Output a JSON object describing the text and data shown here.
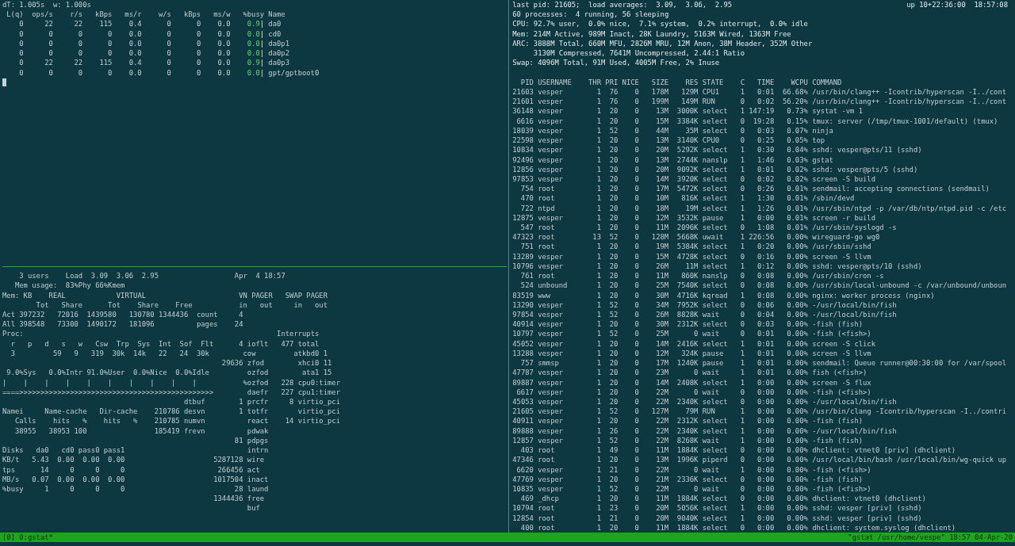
{
  "gstat": {
    "header": "dT: 1.005s  w: 1.000s",
    "columns": [
      "L(q)",
      "ops/s",
      "r/s",
      "kBps",
      "ms/r",
      "w/s",
      "kBps",
      "ms/w",
      "%busy",
      "Name"
    ],
    "rows": [
      {
        "cells": [
          "0",
          "22",
          "22",
          "115",
          "0.4",
          "0",
          "0",
          "0.0"
        ],
        "busy": "0.9",
        "name": "da0"
      },
      {
        "cells": [
          "0",
          "0",
          "0",
          "0",
          "0.0",
          "0",
          "0",
          "0.0"
        ],
        "busy": "0.0",
        "name": "cd0"
      },
      {
        "cells": [
          "0",
          "0",
          "0",
          "0",
          "0.0",
          "0",
          "0",
          "0.0"
        ],
        "busy": "0.0",
        "name": "da0p1"
      },
      {
        "cells": [
          "0",
          "0",
          "0",
          "0",
          "0.0",
          "0",
          "0",
          "0.0"
        ],
        "busy": "0.0",
        "name": "da0p2"
      },
      {
        "cells": [
          "0",
          "22",
          "22",
          "115",
          "0.4",
          "0",
          "0",
          "0.0"
        ],
        "busy": "0.9",
        "name": "da0p3"
      },
      {
        "cells": [
          "0",
          "0",
          "0",
          "0",
          "0.0",
          "0",
          "0",
          "0.0"
        ],
        "busy": "0.0",
        "name": "gpt/gptboot0"
      }
    ]
  },
  "systat": {
    "lines": [
      "    3 users    Load  3.09  3.06  2.95                  Apr  4 18:57",
      "   Mem usage:  83%Phy 66%Kmem",
      "Mem: KB    REAL            VIRTUAL                      VN PAGER   SWAP PAGER",
      "        Tot   Share      Tot    Share    Free           in   out     in   out",
      "Act 397232   72016  1439580   130780 1344436  count     4",
      "All 398548   73300  1490172   181096          pages    24",
      "Proc:                                                            Interrupts",
      "  r   p   d   s   w   Csw  Trp  Sys  Int  Sof  Flt      4 ioflt   477 total",
      "  3         59   9   319  30k  14k   22   24  30k        cow         atkbd0 1",
      "                                                    29636 zfod        xhci0 11",
      " 9.0%Sys   0.0%Intr 91.0%User  0.0%Nice  0.0%Idle         ozfod        ata1 15",
      "|    |    |    |    |    |    |    |    |    |           %ozfod   228 cpu0:timer",
      "====>>>>>>>>>>>>>>>>>>>>>>>>>>>>>>>>>>>>>>>>>>>>>>        daefr   227 cpu1:timer",
      "                                           dtbuf        1 prcfr     8 virtio_pci",
      "Namei     Name-cache   Dir-cache    210786 desvn        1 totfr       virtio_pci",
      "   Calls    hits   %    hits   %    210785 numvn          react    14 virtio_pci",
      "   38955   38953 100                185419 frevn          pdwak",
      "                                                       81 pdpgs",
      "Disks   da0   cd0 pass0 pass1                             intrn",
      "KB/t   5.43  0.00  0.00  0.00                     5287128 wire",
      "tps      14     0     0     0                      266456 act",
      "MB/s   0.07  0.00  0.00  0.00                     1017504 inact",
      "%busy     1     0     0     0                          28 laund",
      "                                                  1344436 free",
      "                                                          buf"
    ]
  },
  "top": {
    "load": "last pid: 21605;  load averages:  3.09,  3.06,  2.95",
    "uptime": "up 10+22:36:00  18:57:08",
    "summary": [
      "60 processes:  4 running, 56 sleeping",
      "CPU: 92.7% user,  0.0% nice,  7.1% system,  0.2% interrupt,  0.0% idle",
      "Mem: 214M Active, 989M Inact, 28K Laundry, 5163M Wired, 1363M Free",
      "ARC: 3888M Total, 660M MFU, 2826M MRU, 12M Anon, 38M Header, 352M Other",
      "     3130M Compressed, 7641M Uncompressed, 2.44:1 Ratio",
      "Swap: 4096M Total, 91M Used, 4005M Free, 2% Inuse"
    ],
    "columns": [
      "PID",
      "USERNAME",
      "THR",
      "PRI",
      "NICE",
      "SIZE",
      "RES",
      "STATE",
      "C",
      "TIME",
      "WCPU",
      "COMMAND"
    ],
    "rows": [
      [
        "21603",
        "vesper",
        "1",
        "76",
        "0",
        "178M",
        "129M",
        "CPU1",
        "1",
        "0:01",
        "66.68%",
        "/usr/bin/clang++ -Icontrib/hyperscan -I../cont"
      ],
      [
        "21601",
        "vesper",
        "1",
        "76",
        "0",
        "199M",
        "149M",
        "RUN",
        "0",
        "0:02",
        "56.20%",
        "/usr/bin/clang++ -Icontrib/hyperscan -I../cont"
      ],
      [
        "36148",
        "vesper",
        "1",
        "20",
        "0",
        "13M",
        "3000K",
        "select",
        "1",
        "147:19",
        "0.73%",
        "systat -vm 1"
      ],
      [
        "6616",
        "vesper",
        "1",
        "20",
        "0",
        "15M",
        "3384K",
        "select",
        "0",
        "19:28",
        "0.15%",
        "tmux: server (/tmp/tmux-1001/default) (tmux)"
      ],
      [
        "18039",
        "vesper",
        "1",
        "52",
        "0",
        "44M",
        "35M",
        "select",
        "0",
        "0:03",
        "0.07%",
        "ninja"
      ],
      [
        "22598",
        "vesper",
        "1",
        "20",
        "0",
        "13M",
        "3140K",
        "CPU0",
        "0",
        "0:25",
        "0.05%",
        "top"
      ],
      [
        "10834",
        "vesper",
        "1",
        "20",
        "0",
        "20M",
        "5292K",
        "select",
        "1",
        "0:30",
        "0.04%",
        "sshd: vesper@pts/11 (sshd)"
      ],
      [
        "92496",
        "vesper",
        "1",
        "20",
        "0",
        "13M",
        "2744K",
        "nanslp",
        "1",
        "1:46",
        "0.03%",
        "gstat"
      ],
      [
        "12856",
        "vesper",
        "1",
        "20",
        "0",
        "20M",
        "9092K",
        "select",
        "1",
        "0:01",
        "0.02%",
        "sshd: vesper@pts/5 (sshd)"
      ],
      [
        "97853",
        "vesper",
        "1",
        "20",
        "0",
        "14M",
        "3920K",
        "select",
        "0",
        "0:02",
        "0.02%",
        "screen -S build"
      ],
      [
        "754",
        "root",
        "1",
        "20",
        "0",
        "17M",
        "5472K",
        "select",
        "0",
        "0:26",
        "0.01%",
        "sendmail: accepting connections (sendmail)"
      ],
      [
        "470",
        "root",
        "1",
        "20",
        "0",
        "10M",
        "816K",
        "select",
        "1",
        "1:30",
        "0.01%",
        "/sbin/devd"
      ],
      [
        "722",
        "ntpd",
        "1",
        "20",
        "0",
        "18M",
        "19M",
        "select",
        "1",
        "1:26",
        "0.01%",
        "/usr/sbin/ntpd -p /var/db/ntp/ntpd.pid -c /etc"
      ],
      [
        "12875",
        "vesper",
        "1",
        "20",
        "0",
        "12M",
        "3532K",
        "pause",
        "1",
        "0:00",
        "0.01%",
        "screen -r build"
      ],
      [
        "547",
        "root",
        "1",
        "20",
        "0",
        "11M",
        "2096K",
        "select",
        "0",
        "1:08",
        "0.01%",
        "/usr/sbin/syslogd -s"
      ],
      [
        "47323",
        "root",
        "13",
        "52",
        "0",
        "128M",
        "5668K",
        "uwait",
        "1",
        "226:56",
        "0.00%",
        "wireguard-go wg0"
      ],
      [
        "751",
        "root",
        "1",
        "20",
        "0",
        "19M",
        "5384K",
        "select",
        "1",
        "0:20",
        "0.00%",
        "/usr/sbin/sshd"
      ],
      [
        "13289",
        "vesper",
        "1",
        "20",
        "0",
        "15M",
        "4728K",
        "select",
        "0",
        "0:16",
        "0.00%",
        "screen -S llvm"
      ],
      [
        "10796",
        "vesper",
        "1",
        "20",
        "0",
        "26M",
        "11M",
        "select",
        "1",
        "0:12",
        "0.00%",
        "sshd: vesper@pts/10 (sshd)"
      ],
      [
        "761",
        "root",
        "1",
        "20",
        "0",
        "11M",
        "860K",
        "nanslp",
        "0",
        "0:08",
        "0.00%",
        "/usr/sbin/cron -s"
      ],
      [
        "524",
        "unbound",
        "1",
        "20",
        "0",
        "25M",
        "7540K",
        "select",
        "0",
        "0:08",
        "0.00%",
        "/usr/sbin/local-unbound -c /var/unbound/unboun"
      ],
      [
        "83519",
        "www",
        "1",
        "20",
        "0",
        "30M",
        "4716K",
        "kqread",
        "1",
        "0:08",
        "0.00%",
        "nginx: worker process (nginx)"
      ],
      [
        "13290",
        "vesper",
        "1",
        "52",
        "0",
        "34M",
        "7952K",
        "select",
        "0",
        "0:06",
        "0.00%",
        "-/usr/local/bin/fish"
      ],
      [
        "97854",
        "vesper",
        "1",
        "52",
        "0",
        "26M",
        "8828K",
        "wait",
        "0",
        "0:04",
        "0.00%",
        "-/usr/local/bin/fish"
      ],
      [
        "40914",
        "vesper",
        "1",
        "20",
        "0",
        "30M",
        "2312K",
        "select",
        "0",
        "0:03",
        "0.00%",
        "-fish (fish)"
      ],
      [
        "10797",
        "vesper",
        "1",
        "52",
        "0",
        "25M",
        "0",
        "wait",
        "0",
        "0:01",
        "0.00%",
        "-fish (<fish>)"
      ],
      [
        "45052",
        "vesper",
        "1",
        "20",
        "0",
        "14M",
        "2416K",
        "select",
        "1",
        "0:01",
        "0.00%",
        "screen -S click"
      ],
      [
        "13288",
        "vesper",
        "1",
        "20",
        "0",
        "12M",
        "324K",
        "pause",
        "1",
        "0:01",
        "0.00%",
        "screen -S llvm"
      ],
      [
        "757",
        "smmsp",
        "1",
        "20",
        "0",
        "17M",
        "1240K",
        "pause",
        "1",
        "0:01",
        "0.00%",
        "sendmail: Queue runner@00:30:00 for /var/spool"
      ],
      [
        "47787",
        "vesper",
        "1",
        "20",
        "0",
        "23M",
        "0",
        "wait",
        "1",
        "0:01",
        "0.00%",
        "fish (<fish>)"
      ],
      [
        "89887",
        "vesper",
        "1",
        "20",
        "0",
        "14M",
        "2408K",
        "select",
        "1",
        "0:00",
        "0.00%",
        "screen -S flux"
      ],
      [
        "6617",
        "vesper",
        "1",
        "20",
        "0",
        "22M",
        "0",
        "wait",
        "0",
        "0:00",
        "0.00%",
        "-fish (<fish>)"
      ],
      [
        "45053",
        "vesper",
        "1",
        "20",
        "0",
        "22M",
        "2340K",
        "select",
        "0",
        "0:00",
        "0.00%",
        "-/usr/local/bin/fish"
      ],
      [
        "21605",
        "vesper",
        "1",
        "52",
        "0",
        "127M",
        "79M",
        "RUN",
        "1",
        "0:00",
        "0.00%",
        "/usr/bin/clang -Icontrib/hyperscan -I../contri"
      ],
      [
        "40911",
        "vesper",
        "1",
        "20",
        "0",
        "22M",
        "2312K",
        "select",
        "1",
        "0:00",
        "0.00%",
        "-fish (fish)"
      ],
      [
        "89888",
        "vesper",
        "1",
        "26",
        "0",
        "22M",
        "2340K",
        "select",
        "1",
        "0:00",
        "0.00%",
        "-/usr/local/bin/fish"
      ],
      [
        "12857",
        "vesper",
        "1",
        "52",
        "0",
        "22M",
        "8268K",
        "wait",
        "1",
        "0:00",
        "0.00%",
        "-fish (fish)"
      ],
      [
        "403",
        "root",
        "1",
        "49",
        "0",
        "11M",
        "1884K",
        "select",
        "0",
        "0:00",
        "0.00%",
        "dhclient: vtnet0 [priv] (dhclient)"
      ],
      [
        "47346",
        "root",
        "1",
        "20",
        "0",
        "13M",
        "1996K",
        "piperd",
        "0",
        "0:00",
        "0.00%",
        "/usr/local/bin/bash /usr/local/bin/wg-quick up"
      ],
      [
        "6620",
        "vesper",
        "1",
        "21",
        "0",
        "22M",
        "0",
        "wait",
        "1",
        "0:00",
        "0.00%",
        "-fish (<fish>)"
      ],
      [
        "47769",
        "vesper",
        "1",
        "20",
        "0",
        "21M",
        "2336K",
        "select",
        "0",
        "0:00",
        "0.00%",
        "-fish (fish)"
      ],
      [
        "10835",
        "vesper",
        "1",
        "52",
        "0",
        "22M",
        "0",
        "wait",
        "0",
        "0:00",
        "0.00%",
        "-fish (<fish>)"
      ],
      [
        "469",
        "_dhcp",
        "1",
        "20",
        "0",
        "11M",
        "1884K",
        "select",
        "0",
        "0:00",
        "0.00%",
        "dhclient: vtnet0 (dhclient)"
      ],
      [
        "10794",
        "root",
        "1",
        "23",
        "0",
        "20M",
        "5056K",
        "select",
        "1",
        "0:00",
        "0.00%",
        "sshd: vesper [priv] (sshd)"
      ],
      [
        "12854",
        "root",
        "1",
        "21",
        "0",
        "20M",
        "9040K",
        "select",
        "1",
        "0:00",
        "0.00%",
        "sshd: vesper [priv] (sshd)"
      ],
      [
        "400",
        "root",
        "1",
        "20",
        "0",
        "11M",
        "1884K",
        "select",
        "0",
        "0:00",
        "0.00%",
        "dhclient: system.syslog (dhclient)"
      ]
    ]
  },
  "status_bar": {
    "window": "[0] 0:gstat*",
    "info": "\"gstat /usr/home/vespe\" 18:57 04-Apr-20"
  }
}
